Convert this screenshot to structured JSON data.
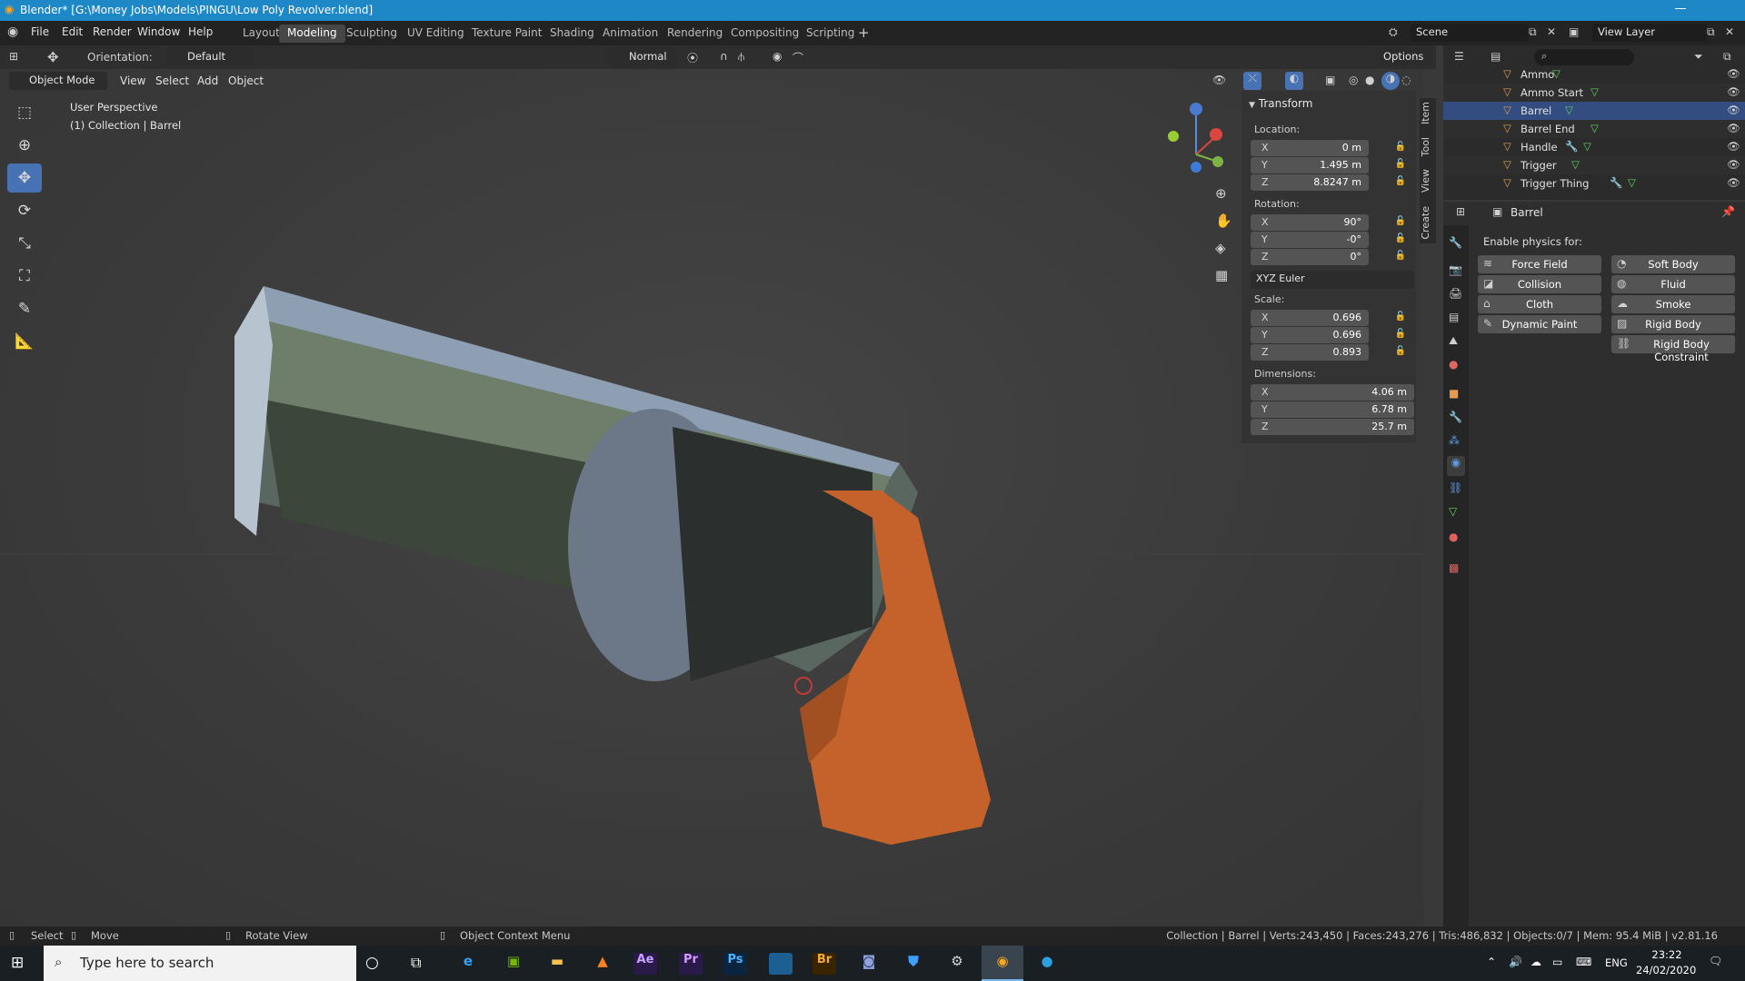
{
  "window": {
    "title": "Blender* [G:\\Money Jobs\\Models\\PINGU\\Low Poly Revolver.blend]"
  },
  "menus": [
    "File",
    "Edit",
    "Render",
    "Window",
    "Help"
  ],
  "workspaces": [
    "Layout",
    "Modeling",
    "Sculpting",
    "UV Editing",
    "Texture Paint",
    "Shading",
    "Animation",
    "Rendering",
    "Compositing",
    "Scripting"
  ],
  "active_workspace": "Modeling",
  "scene": "Scene",
  "view_layer": "View Layer",
  "header": {
    "orientation_label": "Orientation:",
    "orientation_value": "Default",
    "pivot": "Normal",
    "options": "Options"
  },
  "mode": {
    "value": "Object Mode",
    "menus": [
      "View",
      "Select",
      "Add",
      "Object"
    ]
  },
  "viewport": {
    "perspective": "User Perspective",
    "collection": "(1) Collection | Barrel"
  },
  "transform": {
    "title": "Transform",
    "location_label": "Location:",
    "location": {
      "x": "0 m",
      "y": "1.495 m",
      "z": "8.8247 m"
    },
    "rotation_label": "Rotation:",
    "rotation": {
      "x": "90°",
      "y": "-0°",
      "z": "0°"
    },
    "rotation_mode": "XYZ Euler",
    "scale_label": "Scale:",
    "scale": {
      "x": "0.696",
      "y": "0.696",
      "z": "0.893"
    },
    "dimensions_label": "Dimensions:",
    "dimensions": {
      "x": "4.06 m",
      "y": "6.78 m",
      "z": "25.7 m"
    }
  },
  "axes": {
    "x": "X",
    "y": "Y",
    "z": "Z"
  },
  "side_tabs": [
    "Item",
    "Tool",
    "View",
    "Create"
  ],
  "outliner": [
    {
      "name": "Ammo"
    },
    {
      "name": "Ammo Start"
    },
    {
      "name": "Barrel"
    },
    {
      "name": "Barrel End"
    },
    {
      "name": "Handle"
    },
    {
      "name": "Trigger"
    },
    {
      "name": "Trigger Thing"
    }
  ],
  "properties": {
    "object": "Barrel",
    "enable_label": "Enable physics for:",
    "buttons": [
      "Force Field",
      "Soft Body",
      "Collision",
      "Fluid",
      "Cloth",
      "Smoke",
      "Dynamic Paint",
      "Rigid Body"
    ],
    "wide_button": "Rigid Body Constraint"
  },
  "status": {
    "select": "Select",
    "move": "Move",
    "rotate": "Rotate View",
    "context": "Object Context Menu",
    "stats": "Collection | Barrel | Verts:243,450 | Faces:243,276 | Tris:486,832 | Objects:0/7 | Mem: 95.4 MiB | v2.81.16"
  },
  "taskbar": {
    "search": "Type here to search",
    "lang": "ENG",
    "time": "23:22",
    "date": "24/02/2020"
  },
  "colors": {
    "accent": "#4772b3",
    "titlebar": "#1e88c7",
    "handle": "#c5622b"
  }
}
